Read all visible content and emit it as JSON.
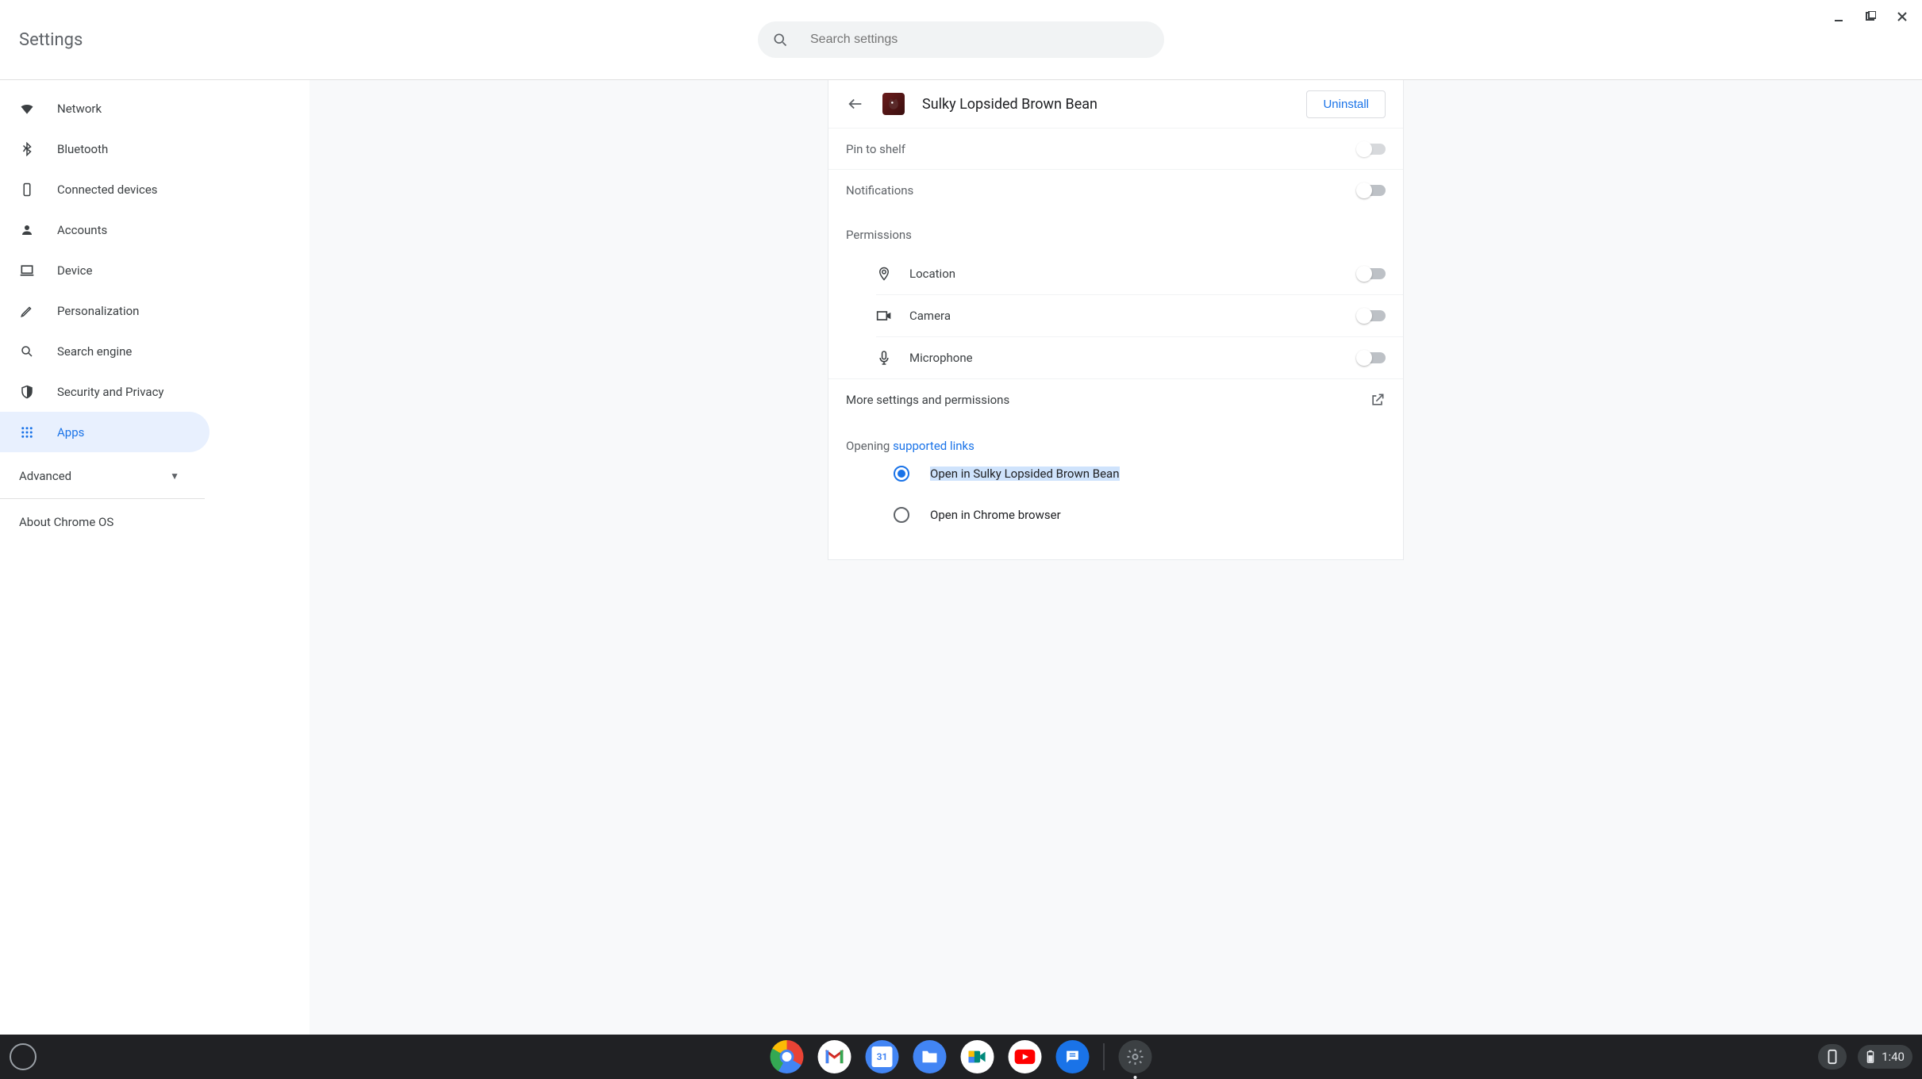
{
  "window": {
    "title": "Settings"
  },
  "search": {
    "placeholder": "Search settings"
  },
  "sidebar": {
    "items": [
      {
        "label": "Network"
      },
      {
        "label": "Bluetooth"
      },
      {
        "label": "Connected devices"
      },
      {
        "label": "Accounts"
      },
      {
        "label": "Device"
      },
      {
        "label": "Personalization"
      },
      {
        "label": "Search engine"
      },
      {
        "label": "Security and Privacy"
      },
      {
        "label": "Apps"
      }
    ],
    "advanced": "Advanced",
    "about": "About Chrome OS"
  },
  "app": {
    "title": "Sulky Lopsided Brown Bean",
    "uninstall": "Uninstall",
    "pin_to_shelf": "Pin to shelf",
    "notifications": "Notifications",
    "permissions_label": "Permissions",
    "permissions": {
      "location": "Location",
      "camera": "Camera",
      "microphone": "Microphone"
    },
    "more_settings": "More settings and permissions",
    "opening_prefix": "Opening ",
    "opening_link": "supported links",
    "radio_open_in_app": "Open in Sulky Lopsided Brown Bean",
    "radio_open_in_chrome": "Open in Chrome browser"
  },
  "shelf": {
    "time": "1:40",
    "calendar_day": "31"
  }
}
